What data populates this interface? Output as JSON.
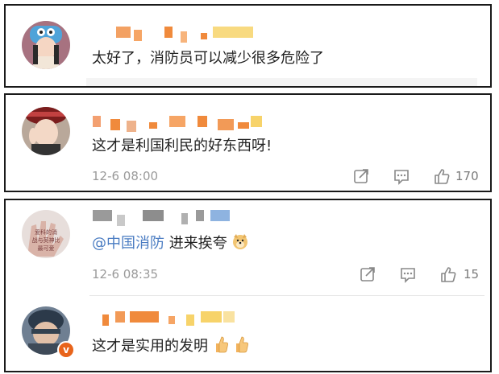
{
  "comments": [
    {
      "text": "太好了，消防员可以减少很多危险了",
      "time": "",
      "likes": ""
    },
    {
      "text": "这才是利国利民的好东西呀!",
      "time": "12-6 08:00",
      "likes": "170"
    },
    {
      "mention": "@中国消防",
      "text": " 进来挨夸",
      "time": "12-6 08:35",
      "likes": "15",
      "avatar_caption": "爱科的消 战与英神比 …… 最可爱"
    },
    {
      "text": "这才是实用的发明",
      "badge": "v"
    }
  ],
  "icons": {
    "share": "share-icon",
    "comment": "comment-icon",
    "like": "thumbs-up-icon",
    "dog": "doge-emoji",
    "thumb": "thumbs-up-emoji"
  },
  "colors": {
    "mention": "#4a7cc2",
    "name_orange": "#f08a3c",
    "name_yellow": "#f7d36a"
  }
}
